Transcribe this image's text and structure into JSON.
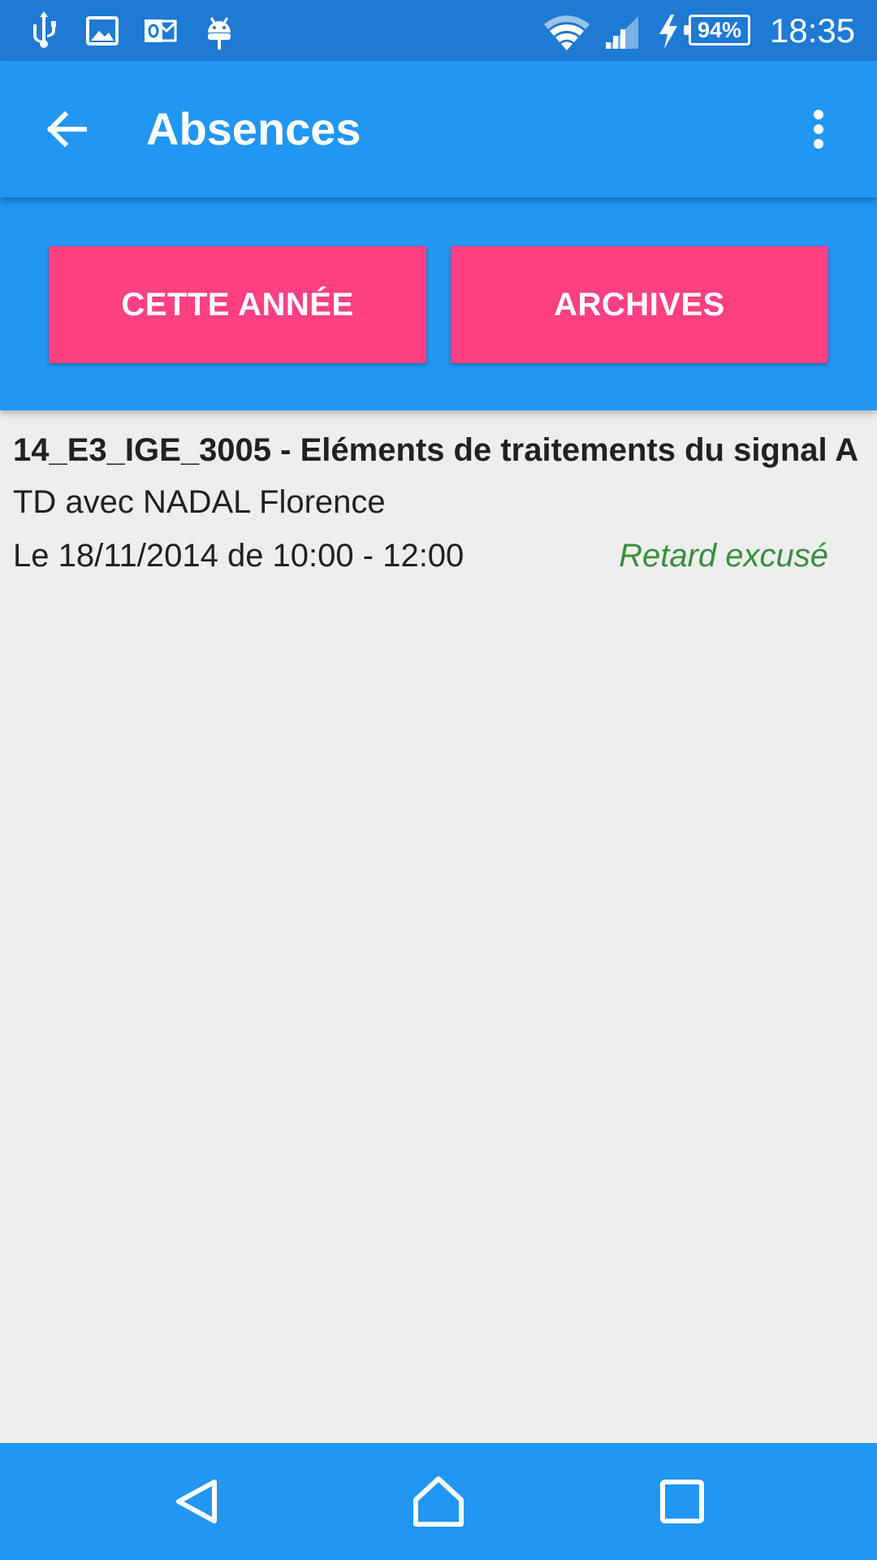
{
  "status_bar": {
    "battery": "94%",
    "time": "18:35",
    "icons": [
      "usb-icon",
      "image-icon",
      "outlook-icon",
      "android-icon",
      "wifi-icon",
      "signal-icon",
      "charging-icon",
      "battery-icon"
    ]
  },
  "app_bar": {
    "title": "Absences",
    "back_icon": "arrow-back-icon",
    "menu_icon": "more-vert-icon"
  },
  "tabs": [
    {
      "label": "CETTE ANNÉE"
    },
    {
      "label": "ARCHIVES"
    }
  ],
  "absences": [
    {
      "title": "14_E3_IGE_3005 - Eléments de traitements du signal A",
      "subtitle": "TD avec NADAL Florence",
      "date": "Le 18/11/2014 de 10:00 - 12:00",
      "status": "Retard excusé"
    }
  ],
  "nav_bar": {
    "icons": [
      "back-triangle-icon",
      "home-icon",
      "recents-square-icon"
    ]
  },
  "colors": {
    "status_bar": "#1e7ad3",
    "primary": "#2196f3",
    "accent": "#ff4081",
    "background": "#eeeeee",
    "status_excused": "#388e3c"
  }
}
